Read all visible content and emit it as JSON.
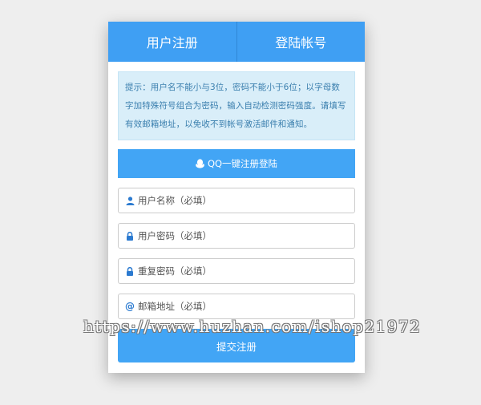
{
  "tabs": {
    "register": "用户注册",
    "login": "登陆帐号"
  },
  "notice": {
    "text": "提示：用户名不能小与3位，密码不能小于6位；以字母数字加特殊符号组合为密码，输入自动检测密码强度。请填写有效邮箱地址，以免收不到帐号激活邮件和通知。"
  },
  "qq_button": {
    "label": "QQ一键注册登陆",
    "icon": "qq-icon"
  },
  "form": {
    "username": {
      "placeholder": "用户名称（必填）",
      "value": "",
      "icon": "user-icon"
    },
    "password": {
      "placeholder": "用户密码（必填）",
      "value": "",
      "icon": "lock-icon"
    },
    "confirm_password": {
      "placeholder": "重复密码（必填）",
      "value": "",
      "icon": "lock-icon"
    },
    "email": {
      "placeholder": "邮箱地址（必填）",
      "value": "",
      "icon": "at-icon"
    }
  },
  "submit": {
    "label": "提交注册"
  },
  "watermark": {
    "text": "https://www.huzhan.com/ishop21972"
  },
  "colors": {
    "primary": "#42a5f5",
    "notice_bg": "#d9eef9",
    "notice_text": "#3b7fae",
    "page_bg": "#eeeeee"
  }
}
